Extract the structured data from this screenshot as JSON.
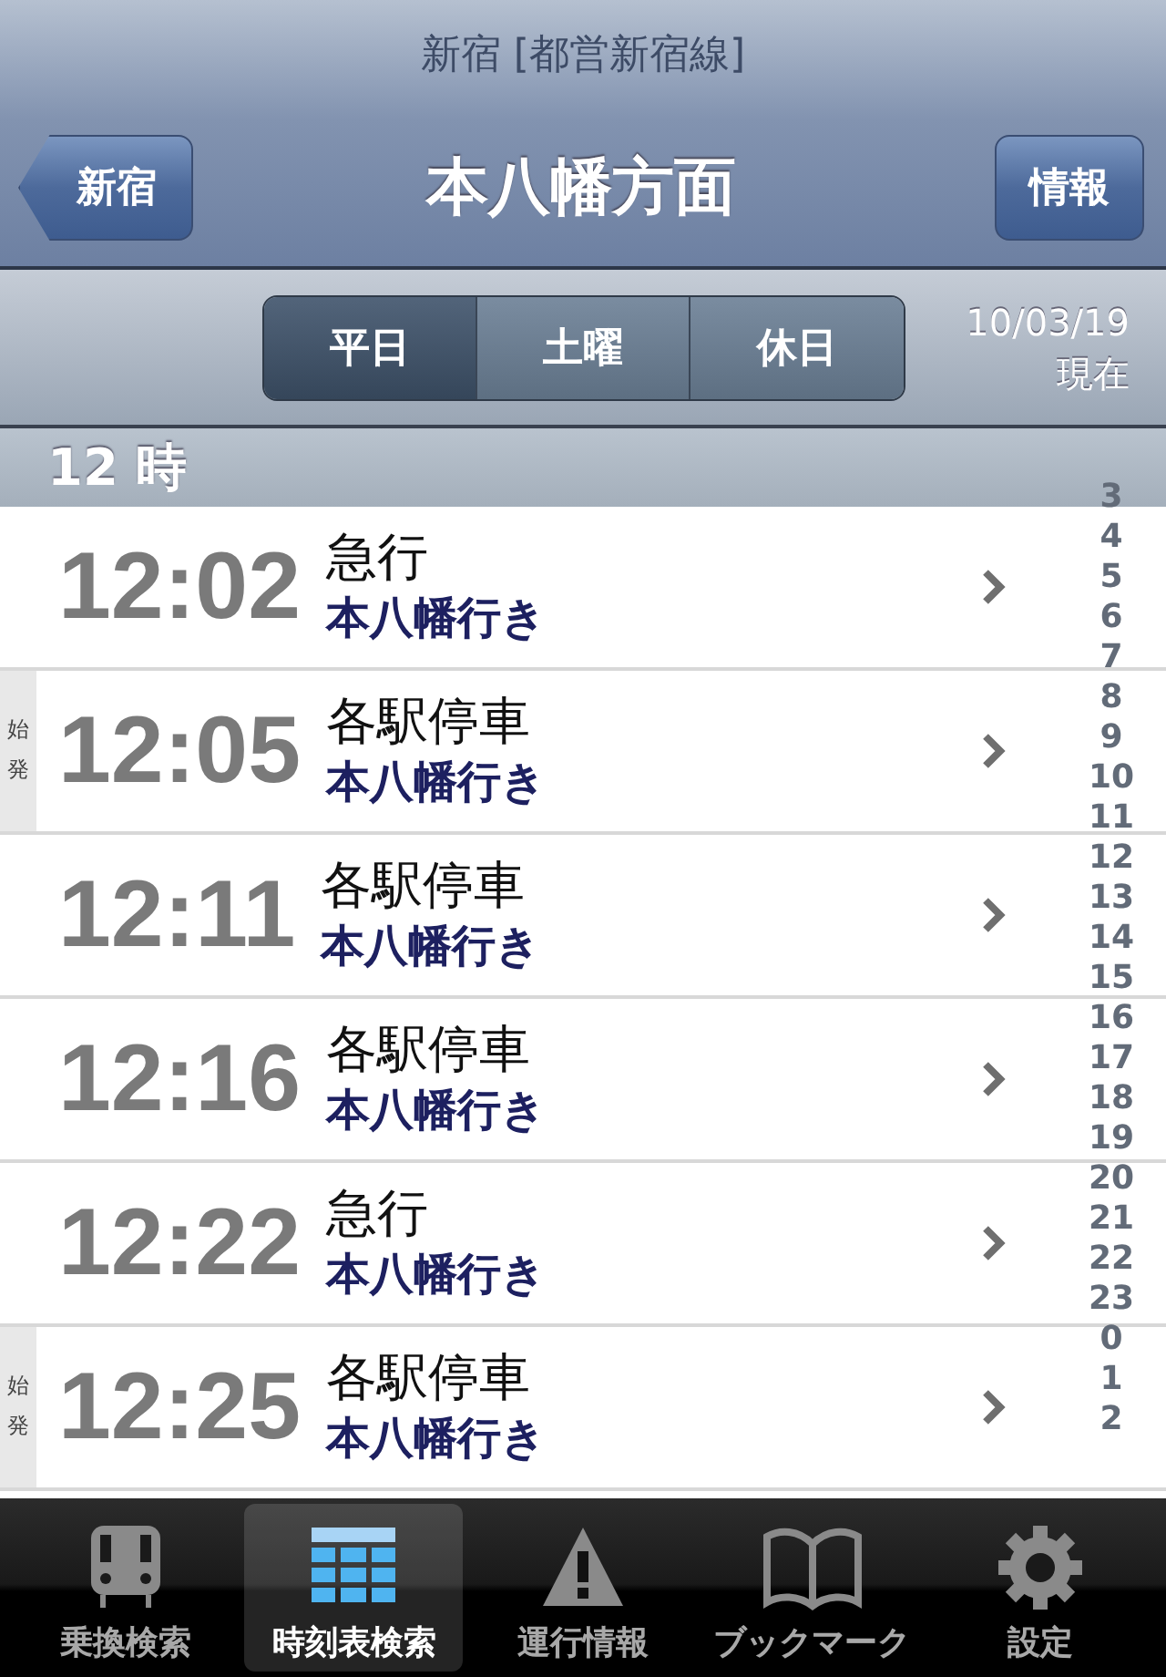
{
  "header": {
    "station": "新宿 [都営新宿線]",
    "title": "本八幡方面",
    "back_button": "新宿",
    "info_button": "情報"
  },
  "day_tabs": [
    {
      "label": "平日",
      "selected": true
    },
    {
      "label": "土曜",
      "selected": false
    },
    {
      "label": "休日",
      "selected": false
    }
  ],
  "date": "10/03/19",
  "date_note": "現在",
  "section": "12 時",
  "departures": [
    {
      "time": "12:02",
      "type": "急行",
      "destination": "本八幡行き"
    },
    {
      "time": "12:05",
      "type": "各駅停車",
      "destination": "本八幡行き",
      "origin_mark": "始発"
    },
    {
      "time": "12:11",
      "type": "各駅停車",
      "destination": "本八幡行き"
    },
    {
      "time": "12:16",
      "type": "各駅停車",
      "destination": "本八幡行き"
    },
    {
      "time": "12:22",
      "type": "急行",
      "destination": "本八幡行き"
    },
    {
      "time": "12:25",
      "type": "各駅停車",
      "destination": "本八幡行き",
      "origin_mark": "始発"
    }
  ],
  "hour_index": [
    "3",
    "4",
    "5",
    "6",
    "7",
    "8",
    "9",
    "10",
    "11",
    "12",
    "13",
    "14",
    "15",
    "16",
    "17",
    "18",
    "19",
    "20",
    "21",
    "22",
    "23",
    "0",
    "1",
    "2"
  ],
  "tab_bar": [
    {
      "label": "乗換検索",
      "kind": "train",
      "selected": false
    },
    {
      "label": "時刻表検索",
      "kind": "timetable",
      "selected": true
    },
    {
      "label": "運行情報",
      "kind": "warning",
      "selected": false
    },
    {
      "label": "ブックマーク",
      "kind": "book",
      "selected": false
    },
    {
      "label": "設定",
      "kind": "gear",
      "selected": false
    }
  ]
}
